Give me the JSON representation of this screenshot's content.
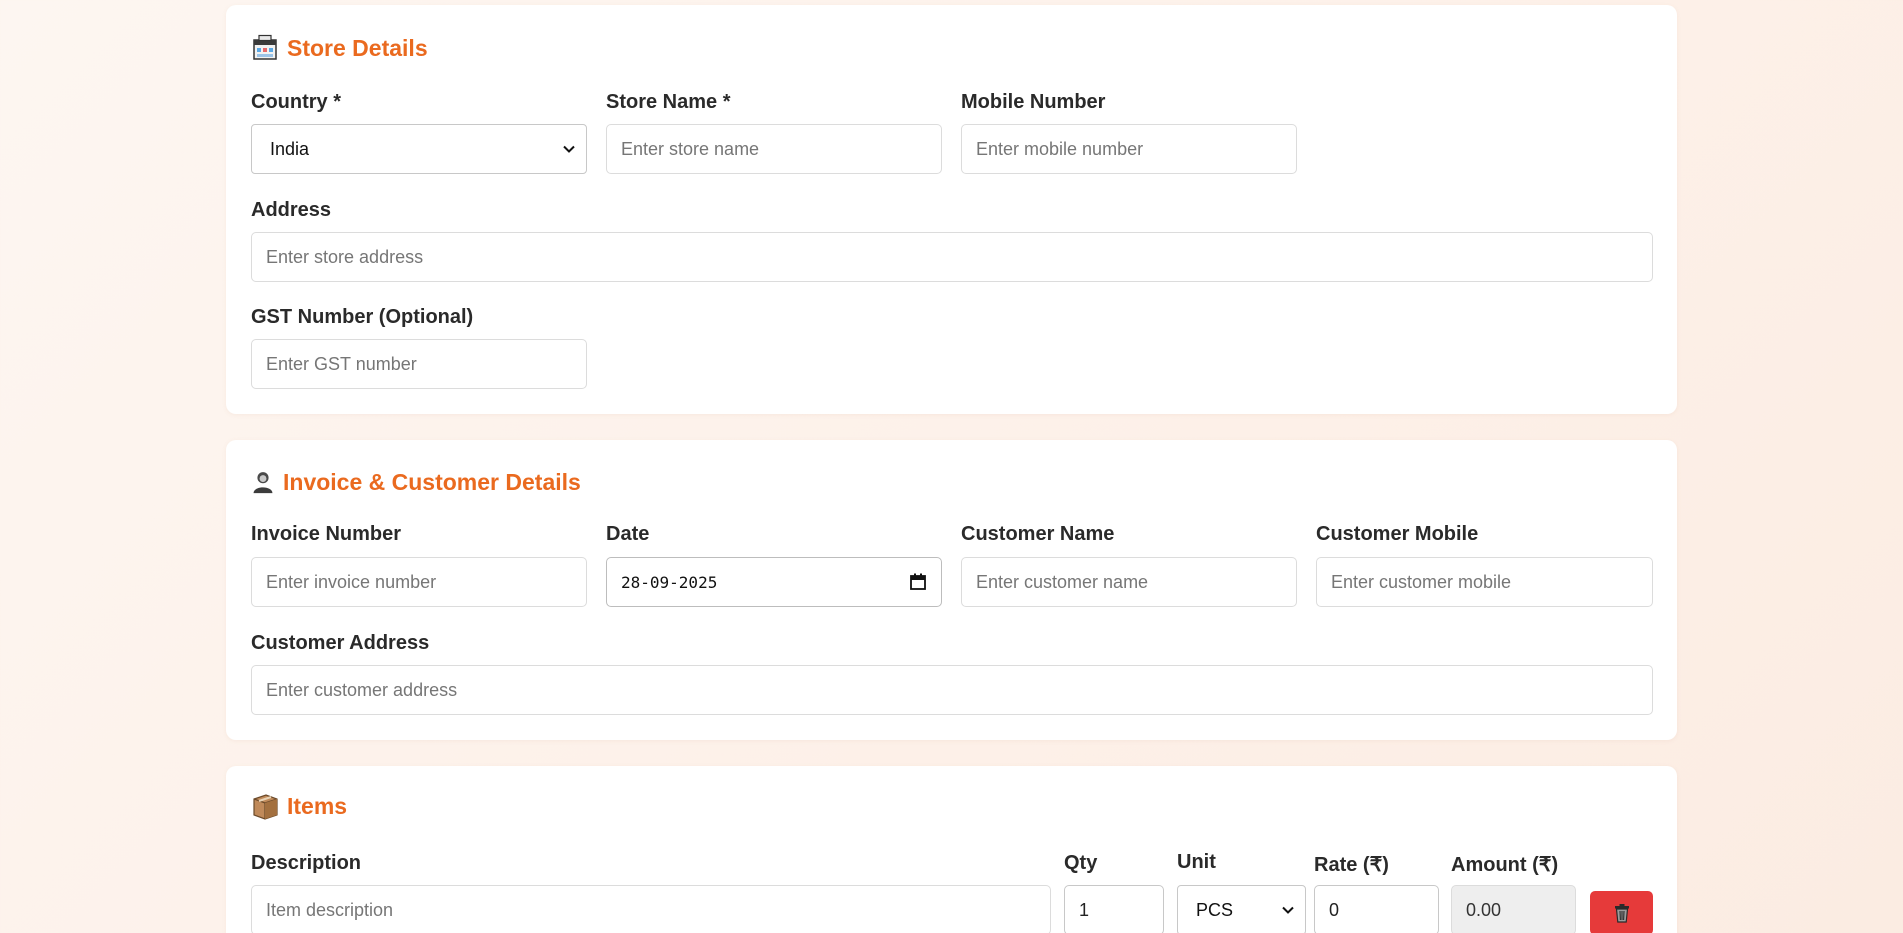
{
  "store": {
    "title": "Store Details",
    "icon": "store-icon",
    "country_label": "Country *",
    "country_value": "India",
    "store_name_label": "Store Name *",
    "store_name_placeholder": "Enter store name",
    "mobile_label": "Mobile Number",
    "mobile_placeholder": "Enter mobile number",
    "address_label": "Address",
    "address_placeholder": "Enter store address",
    "gst_label": "GST Number (Optional)",
    "gst_placeholder": "Enter GST number"
  },
  "invoice": {
    "title": "Invoice & Customer Details",
    "icon": "customer-icon",
    "invoice_number_label": "Invoice Number",
    "invoice_number_placeholder": "Enter invoice number",
    "date_label": "Date",
    "date_value": "28-09-2025",
    "customer_name_label": "Customer Name",
    "customer_name_placeholder": "Enter customer name",
    "customer_mobile_label": "Customer Mobile",
    "customer_mobile_placeholder": "Enter customer mobile",
    "customer_address_label": "Customer Address",
    "customer_address_placeholder": "Enter customer address"
  },
  "items": {
    "title": "Items",
    "icon": "package-icon",
    "columns": {
      "description": "Description",
      "qty": "Qty",
      "unit": "Unit",
      "rate": "Rate (₹)",
      "amount": "Amount (₹)"
    },
    "rows": [
      {
        "description_placeholder": "Item description",
        "qty": "1",
        "unit": "PCS",
        "rate": "0",
        "amount": "0.00"
      }
    ],
    "delete_icon": "trash-icon"
  },
  "colors": {
    "accent": "#ea6a1f",
    "danger": "#e63a3a",
    "card": "#ffffff",
    "background": "#fdf3ec"
  }
}
